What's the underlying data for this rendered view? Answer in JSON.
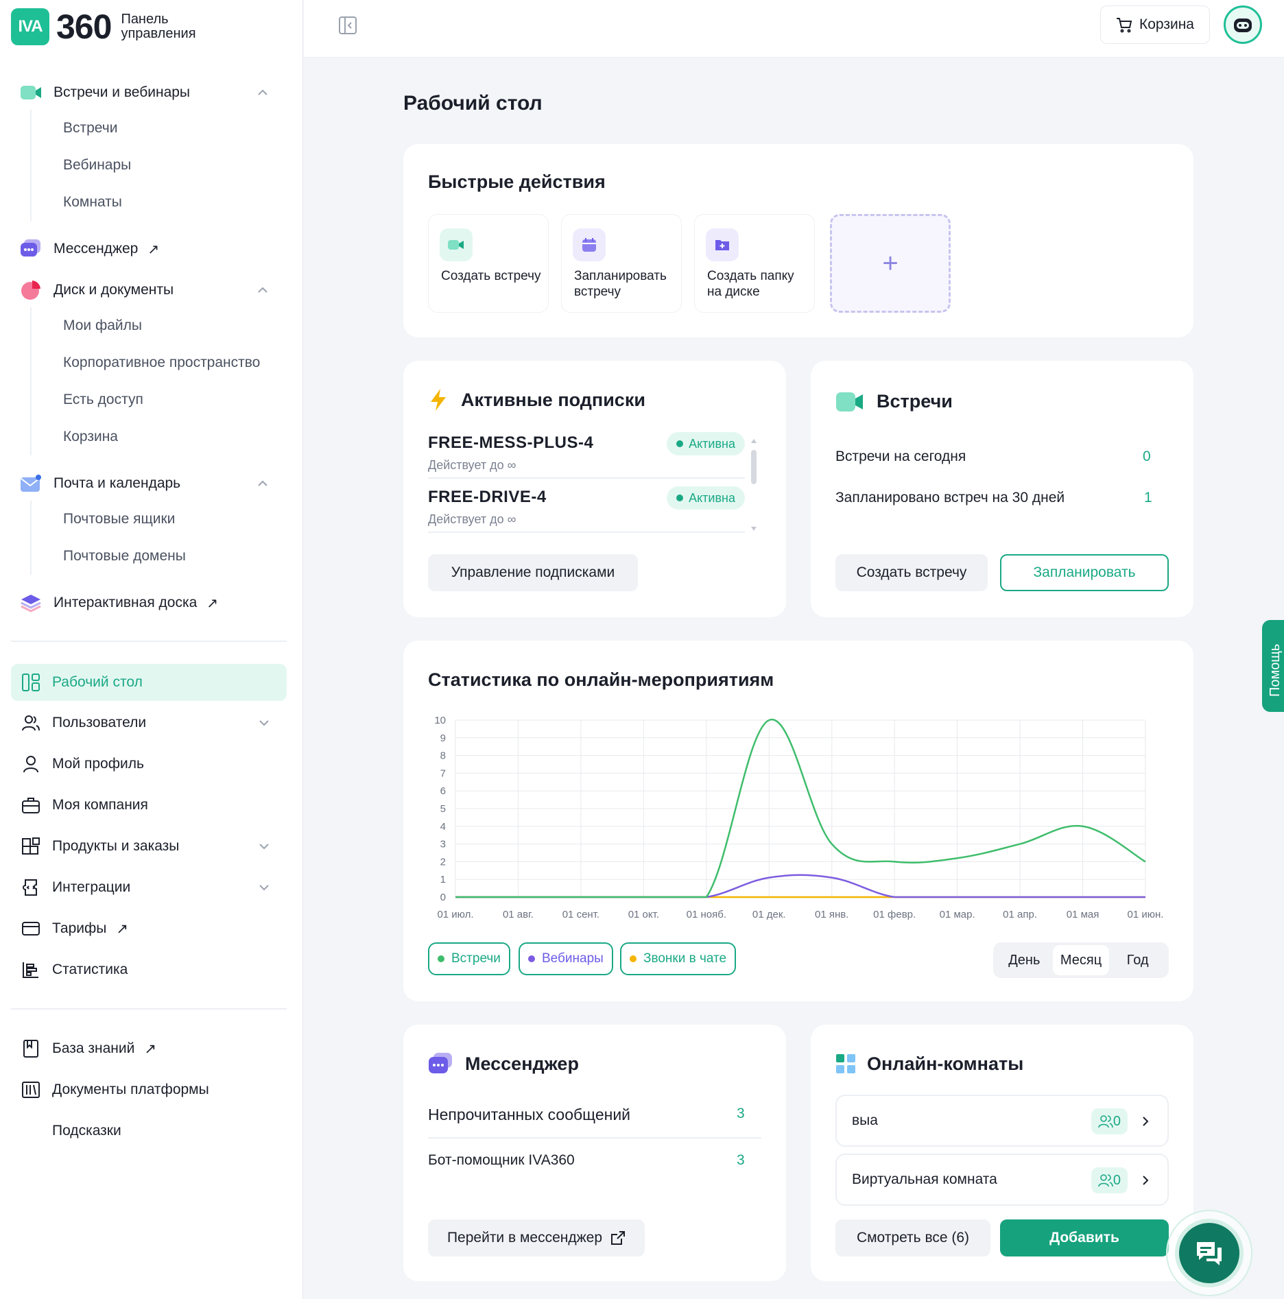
{
  "app": {
    "logo_mark": "IVA",
    "logo_number": "360",
    "logo_text_line1": "Панель",
    "logo_text_line2": "управления"
  },
  "sidebar": {
    "groups": [
      {
        "label": "Встречи и вебинары",
        "items": [
          "Встречи",
          "Вебинары",
          "Комнаты"
        ]
      },
      {
        "label": "Мессенджер"
      },
      {
        "label": "Диск и документы",
        "items": [
          "Мои файлы",
          "Корпоративное пространство",
          "Есть доступ",
          "Корзина"
        ]
      },
      {
        "label": "Почта и календарь",
        "items": [
          "Почтовые ящики",
          "Почтовые домены"
        ]
      },
      {
        "label": "Интерактивная доска"
      }
    ],
    "menu": [
      "Рабочий стол",
      "Пользователи",
      "Мой профиль",
      "Моя компания",
      "Продукты и заказы",
      "Интеграции",
      "Тарифы",
      "Статистика"
    ],
    "bottom": [
      "База знаний",
      "Документы платформы",
      "Подсказки"
    ],
    "ext_arrow": "↗"
  },
  "header": {
    "cart_label": "Корзина"
  },
  "page": {
    "title": "Рабочий стол"
  },
  "quick_actions": {
    "title": "Быстрые действия",
    "items": [
      {
        "label": "Создать встречу"
      },
      {
        "label": "Запланировать встречу"
      },
      {
        "label": "Создать папку на диске"
      }
    ],
    "add_symbol": "+"
  },
  "subscriptions": {
    "title": "Активные подписки",
    "items": [
      {
        "name": "FREE-MESS-PLUS-4",
        "valid": "Действует до ∞",
        "status": "Активна"
      },
      {
        "name": "FREE-DRIVE-4",
        "valid": "Действует до ∞",
        "status": "Активна"
      }
    ],
    "manage_label": "Управление подписками"
  },
  "meetings": {
    "title": "Встречи",
    "today_label": "Встречи на сегодня",
    "today_value": "0",
    "planned_label": "Запланировано встреч на 30 дней",
    "planned_value": "1",
    "create_label": "Создать встречу",
    "schedule_label": "Запланировать"
  },
  "stats": {
    "title": "Статистика по онлайн-мероприятиям",
    "periods": [
      "День",
      "Месяц",
      "Год"
    ],
    "selected_period": "Месяц"
  },
  "chart_data": {
    "type": "line",
    "categories": [
      "01 июл.",
      "01 авг.",
      "01 сент.",
      "01 окт.",
      "01 нояб.",
      "01 дек.",
      "01 янв.",
      "01 февр.",
      "01 мар.",
      "01 апр.",
      "01 мая",
      "01 июн."
    ],
    "ylim": [
      0,
      10
    ],
    "yticks": [
      0,
      1,
      2,
      3,
      4,
      5,
      6,
      7,
      8,
      9,
      10
    ],
    "grid": true,
    "series": [
      {
        "name": "Встречи",
        "color": "#3ebd6b",
        "values": [
          0,
          0,
          0,
          0,
          0,
          10,
          3,
          2,
          2.2,
          3,
          4,
          2
        ]
      },
      {
        "name": "Вебинары",
        "color": "#7c5ce0",
        "values": [
          0,
          0,
          0,
          0,
          0,
          1.1,
          1.1,
          0,
          0,
          0,
          0,
          0
        ]
      },
      {
        "name": "Звонки в чате",
        "color": "#f5b400",
        "values": [
          0,
          0,
          0,
          0,
          0,
          0,
          0,
          0,
          0,
          0,
          0,
          0
        ]
      }
    ]
  },
  "messenger": {
    "title": "Мессенджер",
    "unread_label": "Непрочитанных сообщений",
    "unread_value": "3",
    "bot_label": "Бот-помощник IVA360",
    "bot_value": "3",
    "go_label": "Перейти в мессенджер"
  },
  "rooms": {
    "title": "Онлайн-комнаты",
    "items": [
      {
        "name": "выа",
        "count": "0"
      },
      {
        "name": "Виртуальная комната",
        "count": "0"
      }
    ],
    "view_all_label": "Смотреть все (6)",
    "add_label": "Добавить"
  },
  "help_tab": {
    "label": "Помощь"
  }
}
